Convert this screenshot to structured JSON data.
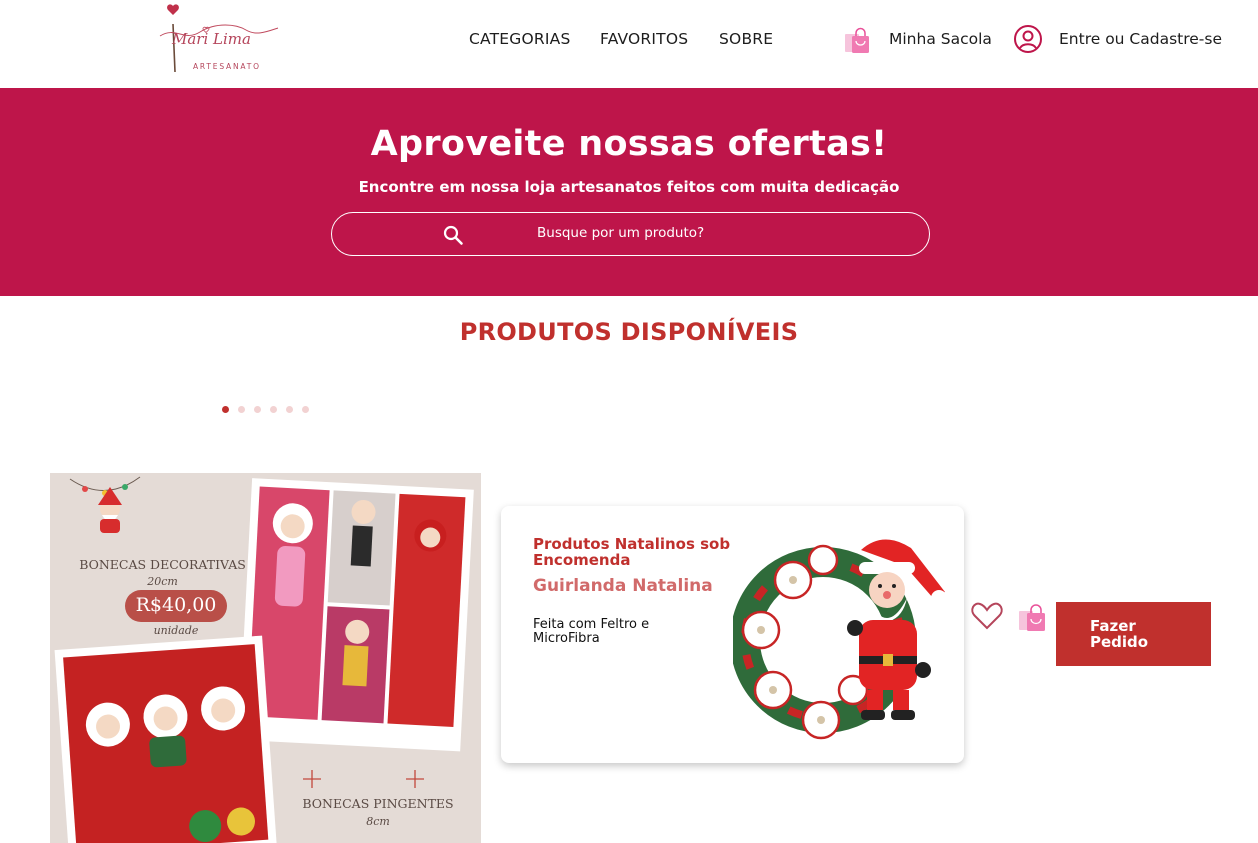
{
  "brand": {
    "logo_name": "Mari Lima",
    "logo_sub": "ARTESANATO"
  },
  "nav": {
    "categories": "CATEGORIAS",
    "favorites": "FAVORITOS",
    "about": "SOBRE",
    "bag": "Minha Sacola",
    "login": "Entre ou Cadastre-se"
  },
  "hero": {
    "title": "Aproveite nossas ofertas!",
    "subtitle": "Encontre em nossa loja artesanatos feitos com muita dedicação",
    "search_placeholder": "Busque por um produto?"
  },
  "section": {
    "title": "PRODUTOS DISPONÍVEIS"
  },
  "carousel": {
    "total_dots": 6,
    "active_index": 0
  },
  "promo": {
    "title1": "BONECAS DECORATIVAS",
    "size1": "20cm",
    "price": "R$40,00",
    "unit": "unidade",
    "title2": "BONECAS PINGENTES",
    "size2": "8cm"
  },
  "product": {
    "category": "Produtos Natalinos sob Encomenda",
    "name": "Guirlanda Natalina",
    "description": "Feita com Feltro e MicroFibra",
    "order_label": "Fazer Pedido"
  },
  "colors": {
    "primary": "#be154a",
    "accent": "#c0302d",
    "name_pink": "#d16a6a",
    "bag_pink": "#f07ab2"
  },
  "icons": [
    "heart-logo-icon",
    "shopping-bag-icon",
    "user-circle-icon",
    "search-icon",
    "heart-outline-icon"
  ]
}
